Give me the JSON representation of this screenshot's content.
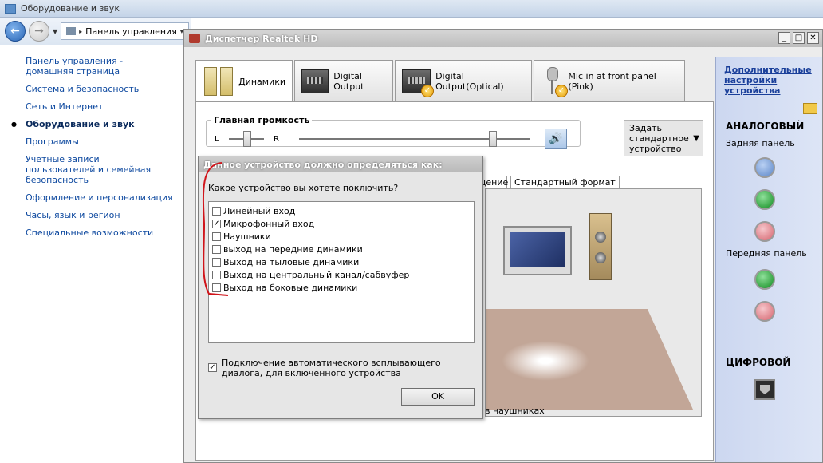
{
  "control_panel": {
    "window_title": "Оборудование и звук",
    "breadcrumb": "Панель управления",
    "nav": [
      {
        "label": "Панель управления - домашняя страница",
        "active": false
      },
      {
        "label": "Система и безопасность",
        "active": false
      },
      {
        "label": "Сеть и Интернет",
        "active": false
      },
      {
        "label": "Оборудование и звук",
        "active": true
      },
      {
        "label": "Программы",
        "active": false
      },
      {
        "label": "Учетные записи пользователей и семейная безопасность",
        "active": false
      },
      {
        "label": "Оформление и персонализация",
        "active": false
      },
      {
        "label": "Часы, язык и регион",
        "active": false
      },
      {
        "label": "Специальные возможности",
        "active": false
      }
    ]
  },
  "realtek": {
    "title": "Диспетчер Realtek HD",
    "tabs": [
      {
        "label": "Динамики",
        "active": true
      },
      {
        "label": "Digital Output",
        "active": false
      },
      {
        "label": "Digital Output(Optical)",
        "active": false
      },
      {
        "label": "Mic in at front panel (Pink)",
        "active": false
      }
    ],
    "main_volume": {
      "label": "Главная громкость",
      "left": "L",
      "right": "R",
      "level": 0.82,
      "balance": 0.5
    },
    "set_default_label": "Задать стандартное устройство",
    "subtabs": [
      "щение",
      "Стандартный формат"
    ],
    "headphones_text": "в наушниках",
    "side": {
      "advanced_link": "Дополнительные настройки устройства",
      "analog": "АНАЛОГОВЫЙ",
      "rear_panel": "Задняя панель",
      "front_panel": "Передняя панель",
      "digital": "ЦИФРОВОЙ"
    }
  },
  "dialog": {
    "title": "Данное устройство должно определяться как:",
    "question": "Какое устройство вы хотете поключить?",
    "options": [
      {
        "label": "Линейный вход",
        "checked": false
      },
      {
        "label": "Микрофонный вход",
        "checked": true
      },
      {
        "label": "Наушники",
        "checked": false
      },
      {
        "label": "выход на передние динамики",
        "checked": false
      },
      {
        "label": "Выход на тыловые динамики",
        "checked": false
      },
      {
        "label": "Выход на центральный канал/сабвуфер",
        "checked": false
      },
      {
        "label": "Выход на боковые динамики",
        "checked": false
      }
    ],
    "auto_popup": {
      "label": "Подключение автоматического всплывающего диалога, для включенного устройства",
      "checked": true
    },
    "ok": "OK"
  }
}
